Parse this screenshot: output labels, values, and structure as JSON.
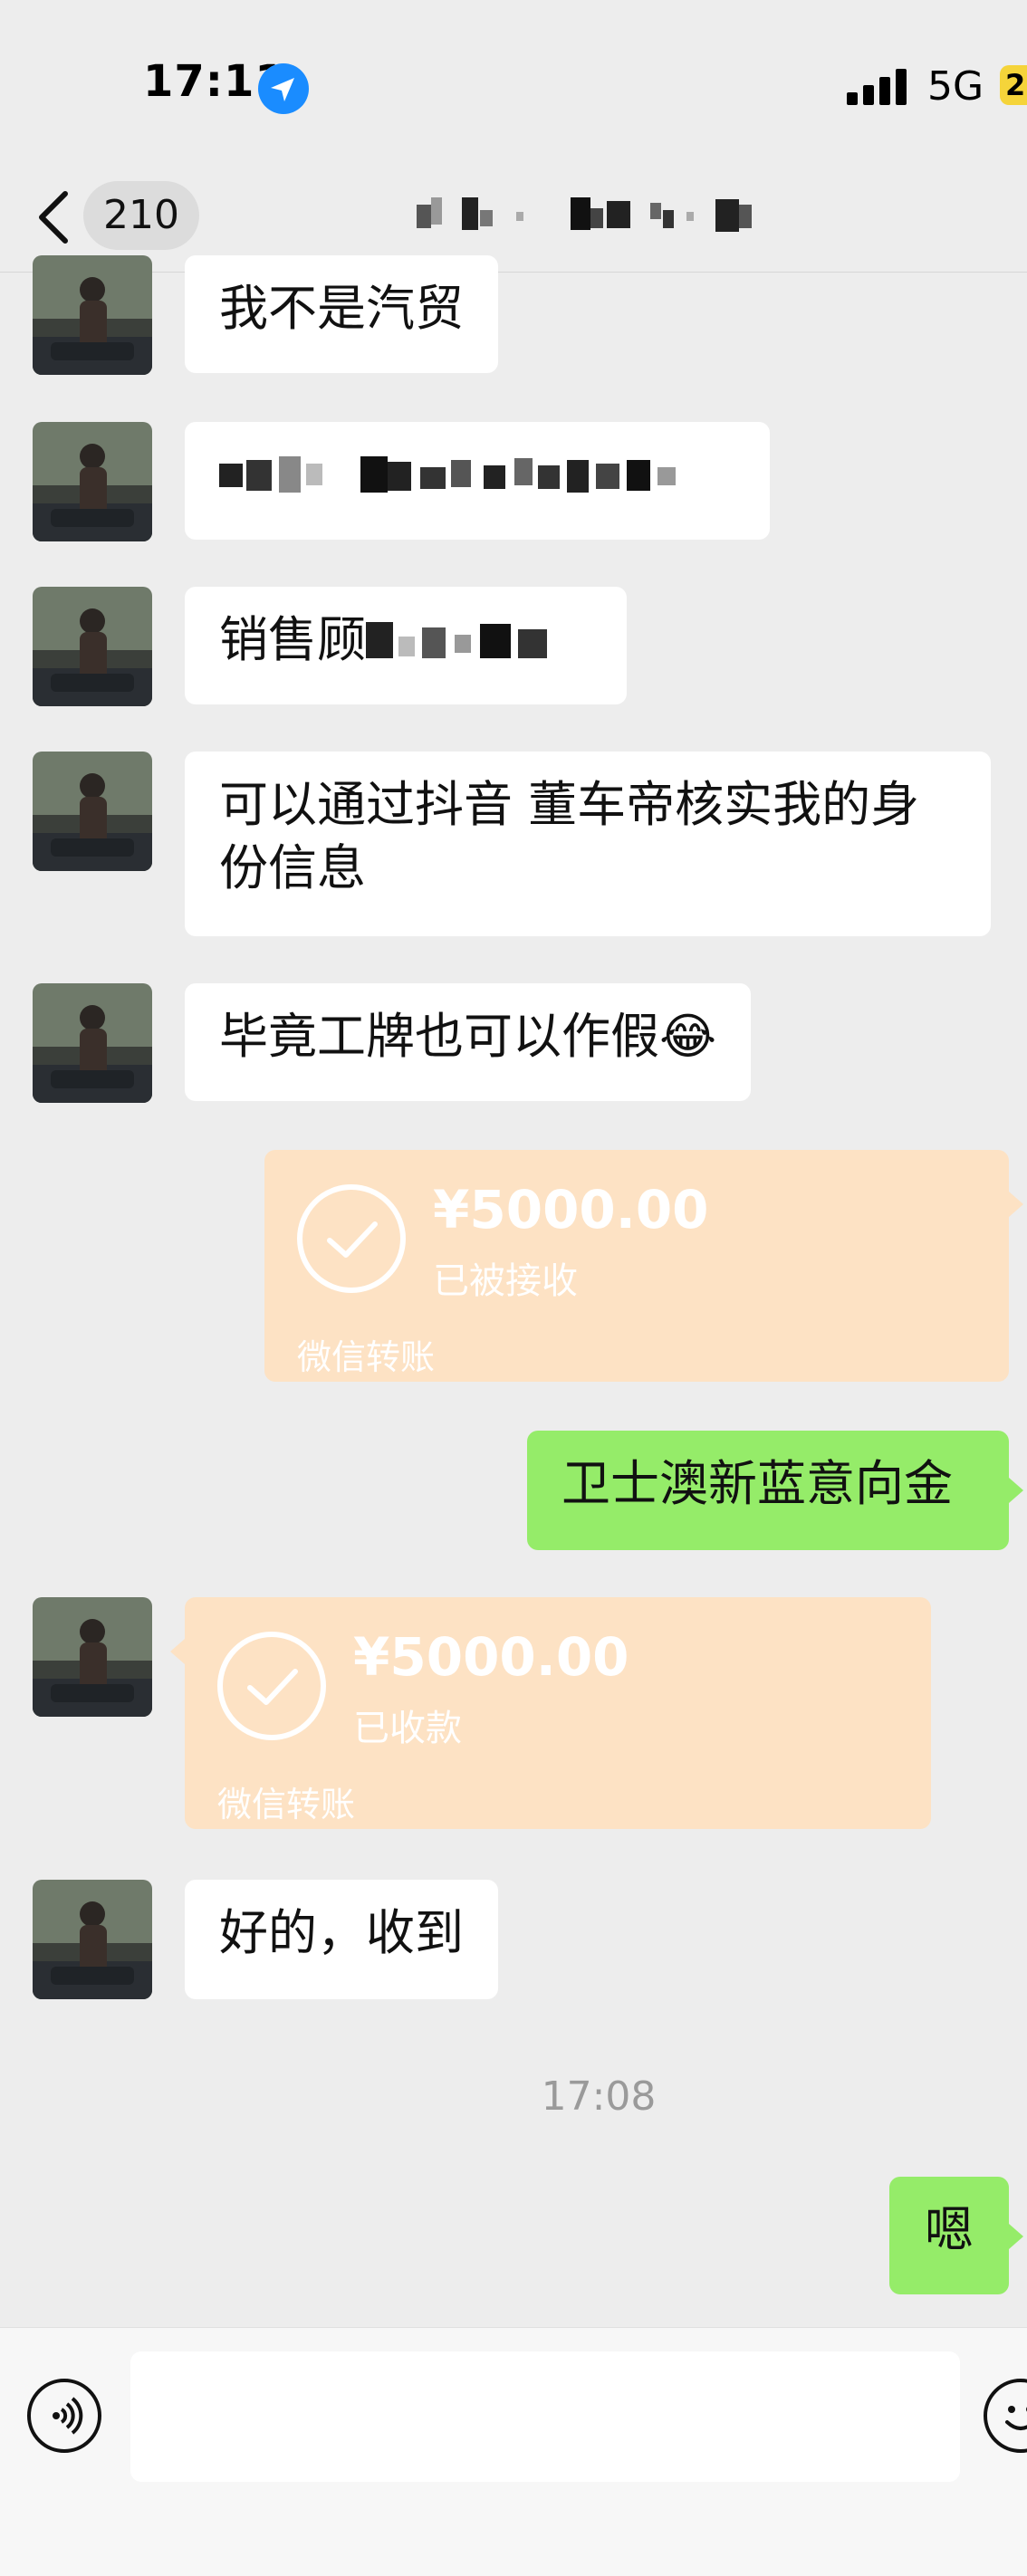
{
  "status_bar": {
    "time": "17:11",
    "network": "5G",
    "battery_label": "2"
  },
  "header": {
    "back_label": "210"
  },
  "messages": {
    "m1": "我不是汽贸",
    "m2_prefix": "",
    "m3_prefix": "销售顾",
    "m4": "可以通过抖音 董车帝核实我的身份信息",
    "m5": "毕竟工牌也可以作假",
    "m5_emoji": "😂",
    "transfer1": {
      "amount": "¥5000.00",
      "status": "已被接收",
      "footer": "微信转账"
    },
    "m6": "卫士澳新蓝意向金",
    "transfer2": {
      "amount": "¥5000.00",
      "status": "已收款",
      "footer": "微信转账"
    },
    "m7": "好的，收到",
    "timestamp": "17:08",
    "m8": "嗯"
  },
  "colors": {
    "outgoing": "#95ec69",
    "incoming": "#ffffff",
    "transfer": "#fde2c4",
    "background": "#ededed"
  },
  "icons": {
    "location": "location-arrow-icon",
    "signal": "signal-icon",
    "back": "chevron-left-icon",
    "voice": "voice-icon",
    "emoji": "emoji-icon"
  }
}
